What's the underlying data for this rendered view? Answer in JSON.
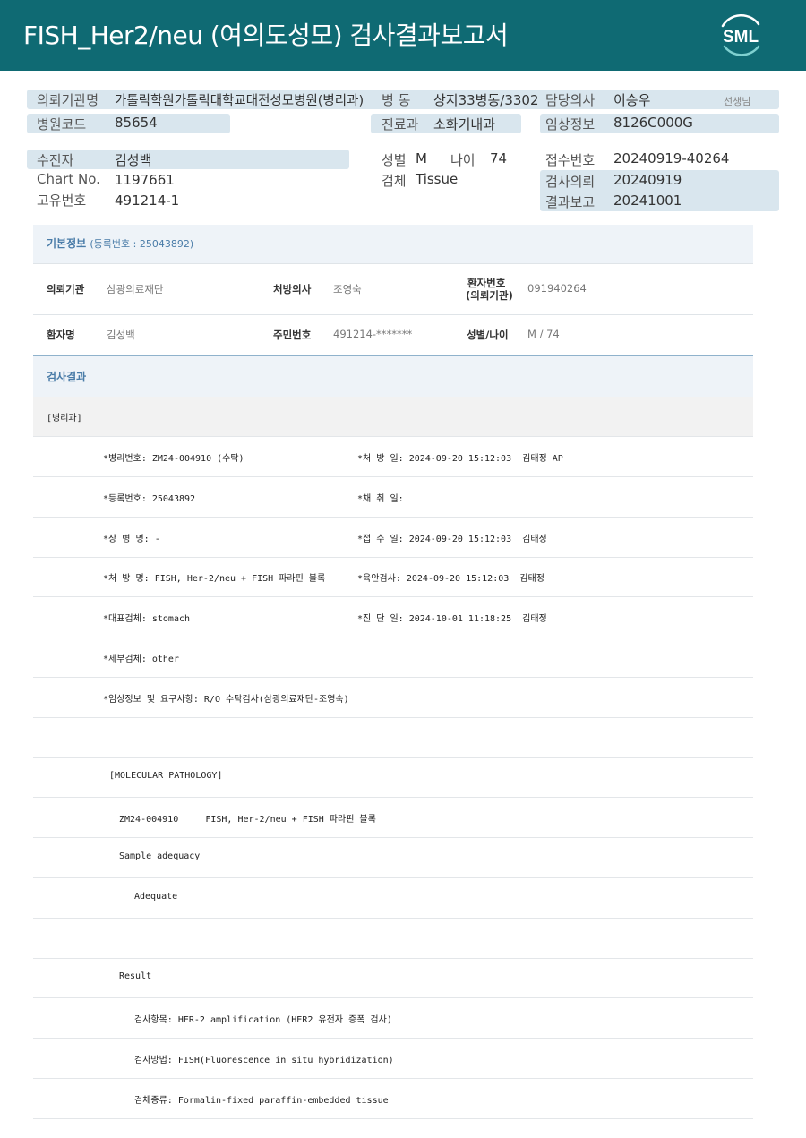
{
  "header": {
    "title": "FISH_Her2/neu  (여의도성모) 검사결과보고서",
    "logo_text": "SML"
  },
  "summary": {
    "requesting_org_label": "의뢰기관명",
    "requesting_org": "가톨릭학원가톨릭대학교대전성모병원(병리과)",
    "ward_label": "병 동",
    "ward": "상지33병동/3302",
    "doctor_label": "담당의사",
    "doctor": "이승우",
    "doctor_suffix": "선생님",
    "hospital_code_label": "병원코드",
    "hospital_code": "85654",
    "department_label": "진료과",
    "department": "소화기내과",
    "clinical_info_label": "임상정보",
    "clinical_info": "8126C000G",
    "patient_label": "수진자",
    "patient": "김성백",
    "sex_label": "성별",
    "sex": "M",
    "age_label": "나이",
    "age": "74",
    "receipt_no_label": "접수번호",
    "receipt_no": "20240919-40264",
    "chart_no_label": "Chart No.",
    "chart_no": "1197661",
    "specimen_label": "검체",
    "specimen": "Tissue",
    "request_date_label": "검사의뢰",
    "request_date": "20240919",
    "unique_no_label": "고유번호",
    "unique_no": "491214-1",
    "report_date_label": "결과보고",
    "report_date": "20241001"
  },
  "basic_info": {
    "title": "기본정보",
    "reg_label": "(등록번호 : 25043892)",
    "org_label": "의뢰기관",
    "org": "삼광의료재단",
    "prescriber_label": "처방의사",
    "prescriber": "조영숙",
    "patient_no_label_1": "환자번호",
    "patient_no_label_2": "(의뢰기관)",
    "patient_no": "091940264",
    "name_label": "환자명",
    "name": "김성백",
    "rrn_label": "주민번호",
    "rrn": "491214-*******",
    "sex_age_label": "성별/나이",
    "sex_age": "M / 74"
  },
  "results": {
    "title": "검사결과",
    "dept": "[병리과]",
    "lines": [
      {
        "left": "*병리번호: ZM24-004910 (수탁)",
        "right": "*처 방 일: 2024-09-20 15:12:03  김태정 AP"
      },
      {
        "left": "*등록번호: 25043892",
        "right": "*채 취 일:"
      },
      {
        "left": "*상 병 명: -",
        "right": "*접 수 일: 2024-09-20 15:12:03  김태정"
      },
      {
        "left": "*처 방 명: FISH, Her-2/neu + FISH 파라핀 블록",
        "right": "*육안검사: 2024-09-20 15:12:03  김태정"
      },
      {
        "left": "*대표검체: stomach",
        "right": "*진 단 일: 2024-10-01 11:18:25  김태정"
      },
      {
        "left": "*세부검체: other",
        "right": ""
      },
      {
        "left": "*임상정보 및 요구사항: R/O 수탁검사(삼광의료재단-조영숙)",
        "right": ""
      },
      {
        "left": "",
        "right": ""
      },
      {
        "left": "[MOLECULAR PATHOLOGY]",
        "right": ""
      },
      {
        "left": "ZM24-004910     FISH, Her-2/neu + FISH 파라핀 블록",
        "right": ""
      },
      {
        "left": "Sample adequacy",
        "right": ""
      },
      {
        "left": "Adequate",
        "right": ""
      },
      {
        "left": "",
        "right": ""
      },
      {
        "left": "Result",
        "right": ""
      },
      {
        "left": "검사항목: HER-2 amplification (HER2 유전자 증폭 검사)",
        "right": ""
      },
      {
        "left": "검사방법: FISH(Fluorescence in situ hybridization)",
        "right": ""
      },
      {
        "left": "검체종류: Formalin-fixed paraffin-embedded tissue",
        "right": ""
      }
    ]
  }
}
